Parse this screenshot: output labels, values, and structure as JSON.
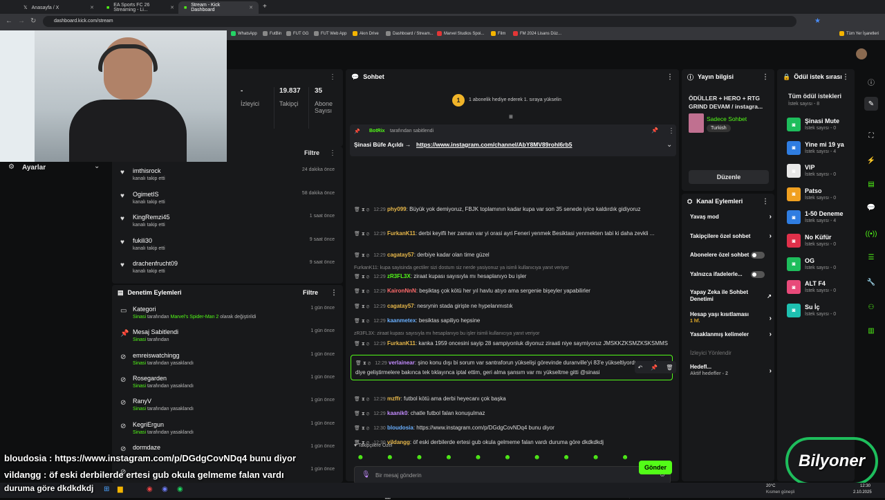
{
  "browser": {
    "tabs": [
      {
        "title": "Anasayfa / X",
        "active": false
      },
      {
        "title": "EA Sports FC 26 Streaming - Li...",
        "active": false
      },
      {
        "title": "Stream - Kick Dashboard",
        "active": true
      }
    ],
    "url": "dashboard.kick.com/stream",
    "bookmarks": [
      "WhatsApp",
      "FutBin",
      "FUT GG",
      "FUT Web App",
      "Akın Drive",
      "Dashboard / Stream...",
      "Marvel Studios Spoi...",
      "Film",
      "FM 2024 Lisans Düz...",
      "Tüm Yer İşaretleri"
    ]
  },
  "stats": [
    {
      "value": "-",
      "label": "İzleyici"
    },
    {
      "value": "19.837",
      "label": "Takipçi"
    },
    {
      "value": "35",
      "label": "Abone Sayısı"
    }
  ],
  "settings_label": "Ayarlar",
  "followers_panel": {
    "filter": "Filtre",
    "items": [
      {
        "name": "imthisrock",
        "sub": "kanalı takip etti",
        "time": "24 dakika önce"
      },
      {
        "name": "OgimetIS",
        "sub": "kanalı takip etti",
        "time": "58 dakika önce"
      },
      {
        "name": "KingRemzi45",
        "sub": "kanalı takip etti",
        "time": "1 saat önce"
      },
      {
        "name": "fukili30",
        "sub": "kanalı takip etti",
        "time": "9 saat önce"
      },
      {
        "name": "drachenfrucht09",
        "sub": "kanalı takip etti",
        "time": "9 saat önce"
      }
    ]
  },
  "moderation_panel": {
    "title": "Denetim Eylemleri",
    "filter": "Filtre",
    "items": [
      {
        "title": "Kategori",
        "actor": "Sinasi",
        "mid": " tarafından ",
        "target": "Marvel's Spider-Man 2",
        "rest": " olarak değiştirildi",
        "time": "1 gün önce"
      },
      {
        "title": "Mesaj Sabitlendi",
        "actor": "Sinasi",
        "mid": " tarafından",
        "target": "",
        "rest": "",
        "time": "1 gün önce"
      },
      {
        "title": "emreiswatchingg",
        "actor": "Sinasi",
        "mid": " tarafından yasaklandı",
        "target": "",
        "rest": "",
        "time": "1 gün önce"
      },
      {
        "title": "Rosegarden",
        "actor": "Sinasi",
        "mid": " tarafından yasaklandı",
        "target": "",
        "rest": "",
        "time": "1 gün önce"
      },
      {
        "title": "RanyV",
        "actor": "Sinasi",
        "mid": " tarafından yasaklandı",
        "target": "",
        "rest": "",
        "time": "1 gün önce"
      },
      {
        "title": "KegriErgun",
        "actor": "Sinasi",
        "mid": " tarafından yasaklandı",
        "target": "",
        "rest": "",
        "time": "1 gün önce"
      },
      {
        "title": "dormdaze",
        "actor": "",
        "mid": "",
        "target": "",
        "rest": "",
        "time": "1 gün önce"
      },
      {
        "title": "",
        "actor": "",
        "mid": "",
        "target": "",
        "rest": "",
        "time": "1 gün önce"
      }
    ]
  },
  "chat": {
    "title": "Sohbet",
    "gift_banner_badge": "1",
    "gift_banner": "1 abonelik hediye ederek 1. sıraya yükselin",
    "pinned_by_user": "BotRix",
    "pinned_by_text": "tarafından sabitlendi",
    "pinned_text": "Şinasi Büfe Açıldı → ",
    "pinned_link": "https://www.instagram.com/channel/AbY8MV89rohl6rb5",
    "messages": [
      {
        "time": "12:29",
        "user": "phy099",
        "color": "#e8b84a",
        "text": "Büyük yok demiyoruz, FBJK toplamının kadar kupa var son 35 senede iyice kaldırdık gidiyoruz"
      },
      {
        "time": "12:29",
        "user": "FurkanK11",
        "color": "#e8b84a",
        "text": "derbi keyifli her zaman var yi orasi ayri Feneri yenmek Besiktasi yenmekten tabi ki daha zevkli ..."
      },
      {
        "time": "12:29",
        "user": "cagatay57",
        "color": "#e8b84a",
        "text": "derbiye kadar olan time güzel"
      },
      {
        "reply": "FurkanK11: kupa sayisinda gectiler sizi dostum siz nerde yasiyonuz ya isimli kullanıcıya yanıt veriyor"
      },
      {
        "time": "12:29",
        "user": "zR3FL3X",
        "color": "#53fc18",
        "text": "ziraat kupası sayısıyla mı hesaplanıyo bu işler"
      },
      {
        "time": "12:29",
        "user": "KaironNnN",
        "color": "#ff6b6b",
        "text": "beşiktaş çok kötü her yıl havlu atıyo ama sergenie bişeyler yapabilirler"
      },
      {
        "time": "12:29",
        "user": "cagatay57",
        "color": "#e8b84a",
        "text": "nesrynin stada girişte ne hypelanmıstık"
      },
      {
        "time": "12:29",
        "user": "kaanmetex",
        "color": "#6ab0ff",
        "text": "besiktas sapiliyo hepsine"
      },
      {
        "reply": "zR3FL3X: ziraat kupası sayısıyla mı hesaplanıyo bu işler isimli kullanıcıya yanıt veriyor"
      },
      {
        "time": "12:29",
        "user": "FurkanK11",
        "color": "#e8b84a",
        "text": "kanka 1959 oncesini sayip 28 sampiyonluk diyonuz ziraati niye saymiyoruz JMSKKZKSMZKSKSMMS"
      },
      {
        "time": "12:29",
        "user": "verlainear",
        "color": "#c48cff",
        "text": "şino konu dışı bi sorum var santraforun yükselişi görevinde duranville'yi 83'e yükseltiyordum ne olmuş diye geliştirmelere bakınca tek tıklayınca iptal ettim, geri alma şansım var mı yükseltme gitti @sinasi",
        "highlight": true
      },
      {
        "time": "12:29",
        "user": "mzffr",
        "color": "#e8b84a",
        "text": "futbol kötü ama derbi heyecanı çok başka"
      },
      {
        "time": "12:29",
        "user": "kaanik0",
        "color": "#c48cff",
        "text": "chatle futbol falan konuşulmaz"
      },
      {
        "time": "12:30",
        "user": "bloudosia",
        "color": "#6ab0ff",
        "text": "https://www.instagram.com/p/DGdgCovNDq4 bunu diyor"
      },
      {
        "time": "12:30",
        "user": "vildangg",
        "color": "#e8b84a",
        "text": "öf eski derbilerde ertesi gub okula gelmeme falan vardı duruma göre dkdkdkdj"
      }
    ],
    "follower_only_label": "Takipçilere Özel",
    "input_placeholder": "Bir mesaj gönderin",
    "send_label": "Gönder"
  },
  "stream_info": {
    "title": "Yayın bilgisi",
    "stream_title": "ÖDÜLLER + HERO + RTG GRIND DEVAM / instagra...",
    "category": "Sadece Sohbet",
    "language": "Turkish",
    "edit_label": "Düzenle"
  },
  "channel_actions": {
    "title": "Kanal Eylemleri",
    "items": [
      {
        "label": "Yavaş mod",
        "kind": "arrow"
      },
      {
        "label": "Takipçilere özel sohbet",
        "kind": "arrow"
      },
      {
        "label": "Abonelere özel sohbet",
        "kind": "toggle"
      },
      {
        "label": "Yalnızca ifadelerle...",
        "kind": "toggle"
      },
      {
        "label": "Yapay Zeka ile Sohbet Denetimi",
        "kind": "ext"
      },
      {
        "label": "Hesap yaşı kısıtlaması",
        "sub": "1 hf.",
        "kind": "arrow"
      },
      {
        "label": "Yasaklanmış kelimeler",
        "kind": "arrow"
      },
      {
        "label": "İzleyici Yönlendir",
        "kind": "disabled"
      },
      {
        "label": "Hedefl...",
        "sub": "Aktif hedefler - 2",
        "kind": "arrow"
      }
    ]
  },
  "rewards": {
    "title": "Ödül istek sırası",
    "all_label": "Tüm ödül istekleri",
    "all_count": "İstek sayısı - 8",
    "items": [
      {
        "name": "Şinasi Mute",
        "count": "İstek sayısı - 0",
        "color": "#1ebd5c"
      },
      {
        "name": "Yine mi 19 ya",
        "count": "İstek sayısı - 4",
        "color": "#2f7de1"
      },
      {
        "name": "VIP",
        "count": "İstek sayısı - 0",
        "color": "#e8e8e8"
      },
      {
        "name": "Patso",
        "count": "İstek sayısı - 0",
        "color": "#f0a020"
      },
      {
        "name": "1-50 Deneme",
        "count": "İstek sayısı - 4",
        "color": "#2f7de1"
      },
      {
        "name": "No Küfür",
        "count": "İstek sayısı - 0",
        "color": "#e0304a"
      },
      {
        "name": "OG",
        "count": "İstek sayısı - 0",
        "color": "#1ebd5c"
      },
      {
        "name": "ALT F4",
        "count": "İstek sayısı - 0",
        "color": "#e84a7a"
      },
      {
        "name": "Su İç",
        "count": "İstek sayısı - 0",
        "color": "#1ec0b0"
      }
    ]
  },
  "overlay": {
    "line1": "bloudosia : https://www.instagram.com/p/DGdgCovNDq4 bunu diyor",
    "line2": "vildangg : öf eski derbilerde ertesi gub okula gelmeme falan vardı",
    "line3": "duruma göre dkdkdkdj",
    "logo": "Bilyoner"
  },
  "taskbar": {
    "weather": "20°C",
    "weather_sub": "Kısmen güneşli",
    "time": "12:30",
    "date": "2.10.2025"
  },
  "colors": {
    "accent": "#53fc18",
    "panel": "#18191b",
    "bg": "#0e0f10"
  }
}
